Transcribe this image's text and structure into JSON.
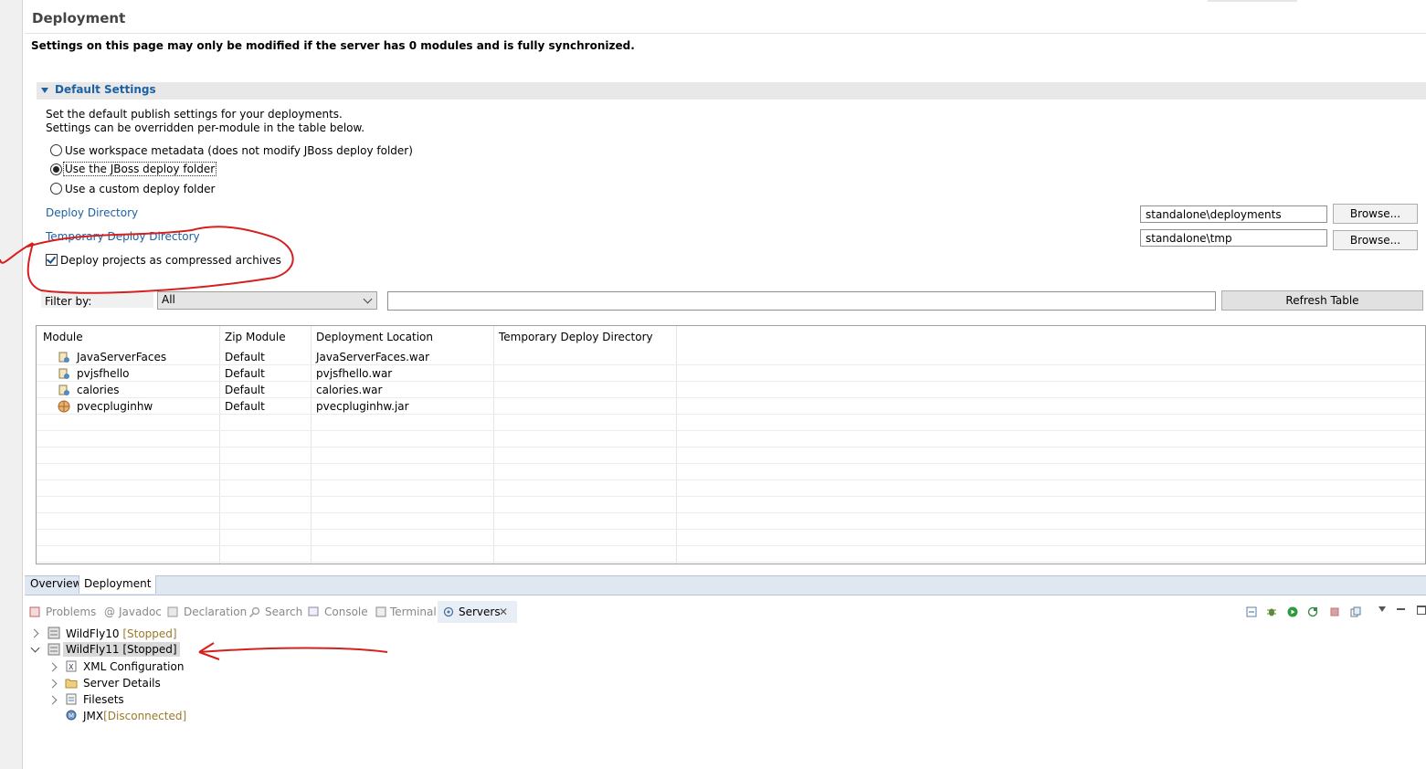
{
  "editor": {
    "title": "Deployment",
    "warning": "Settings on this page may only be modified if the server has 0 modules and is fully synchronized.",
    "section_title": "Default Settings",
    "description_line1": "Set the default publish settings for your deployments.",
    "description_line2": "Settings can be overridden per-module in the table below.",
    "radios": [
      {
        "label": "Use workspace metadata (does not modify JBoss deploy folder)",
        "selected": false
      },
      {
        "label": "Use the JBoss deploy folder",
        "selected": true
      },
      {
        "label": "Use a custom deploy folder",
        "selected": false
      }
    ],
    "deploy_dir_label": "Deploy Directory",
    "deploy_dir_value": "standalone\\deployments",
    "temp_dir_label": "Temporary Deploy Directory",
    "temp_dir_value": "standalone\\tmp",
    "browse_label": "Browse...",
    "compressed_label": "Deploy projects as compressed archives",
    "compressed_checked": true,
    "filter_label": "Filter by:",
    "filter_value": "All",
    "filter_text": "",
    "refresh_label": "Refresh Table"
  },
  "table": {
    "columns": [
      "Module",
      "Zip Module",
      "Deployment Location",
      "Temporary Deploy Directory"
    ],
    "rows": [
      {
        "module": "JavaServerFaces",
        "zip": "Default",
        "location": "JavaServerFaces.war",
        "temp": "",
        "icon": "web-module-icon"
      },
      {
        "module": "pvjsfhello",
        "zip": "Default",
        "location": "pvjsfhello.war",
        "temp": "",
        "icon": "web-module-icon"
      },
      {
        "module": "calories",
        "zip": "Default",
        "location": "calories.war",
        "temp": "",
        "icon": "web-module-icon"
      },
      {
        "module": "pvecpluginhw",
        "zip": "Default",
        "location": "pvecpluginhw.jar",
        "temp": "",
        "icon": "plugin-module-icon"
      }
    ]
  },
  "editor_tabs": [
    "Overview",
    "Deployment"
  ],
  "active_editor_tab": "Deployment",
  "views": {
    "tabs": [
      "Problems",
      "Javadoc",
      "Declaration",
      "Search",
      "Console",
      "Terminal",
      "Servers"
    ],
    "active": "Servers",
    "toolbar_icons": [
      "collapse-icon",
      "debug-icon",
      "start-icon",
      "profile-icon",
      "stop-icon",
      "publish-icon",
      "view-menu-icon",
      "minimize-icon",
      "maximize-icon"
    ]
  },
  "servers": [
    {
      "name": "WildFly10",
      "state": "[Stopped]",
      "expanded": false
    },
    {
      "name": "WildFly11",
      "state": "[Stopped]",
      "expanded": true,
      "children": [
        {
          "label": "XML Configuration",
          "icon": "xml-icon"
        },
        {
          "label": "Server Details",
          "icon": "folder-icon"
        },
        {
          "label": "Filesets",
          "icon": "fileset-icon"
        },
        {
          "label": "JMX",
          "state": "[Disconnected]",
          "icon": "jmx-icon"
        }
      ]
    }
  ],
  "colors": {
    "link": "#1d61a3",
    "annotation": "#d61f1f",
    "state": "#9a7a2a"
  }
}
